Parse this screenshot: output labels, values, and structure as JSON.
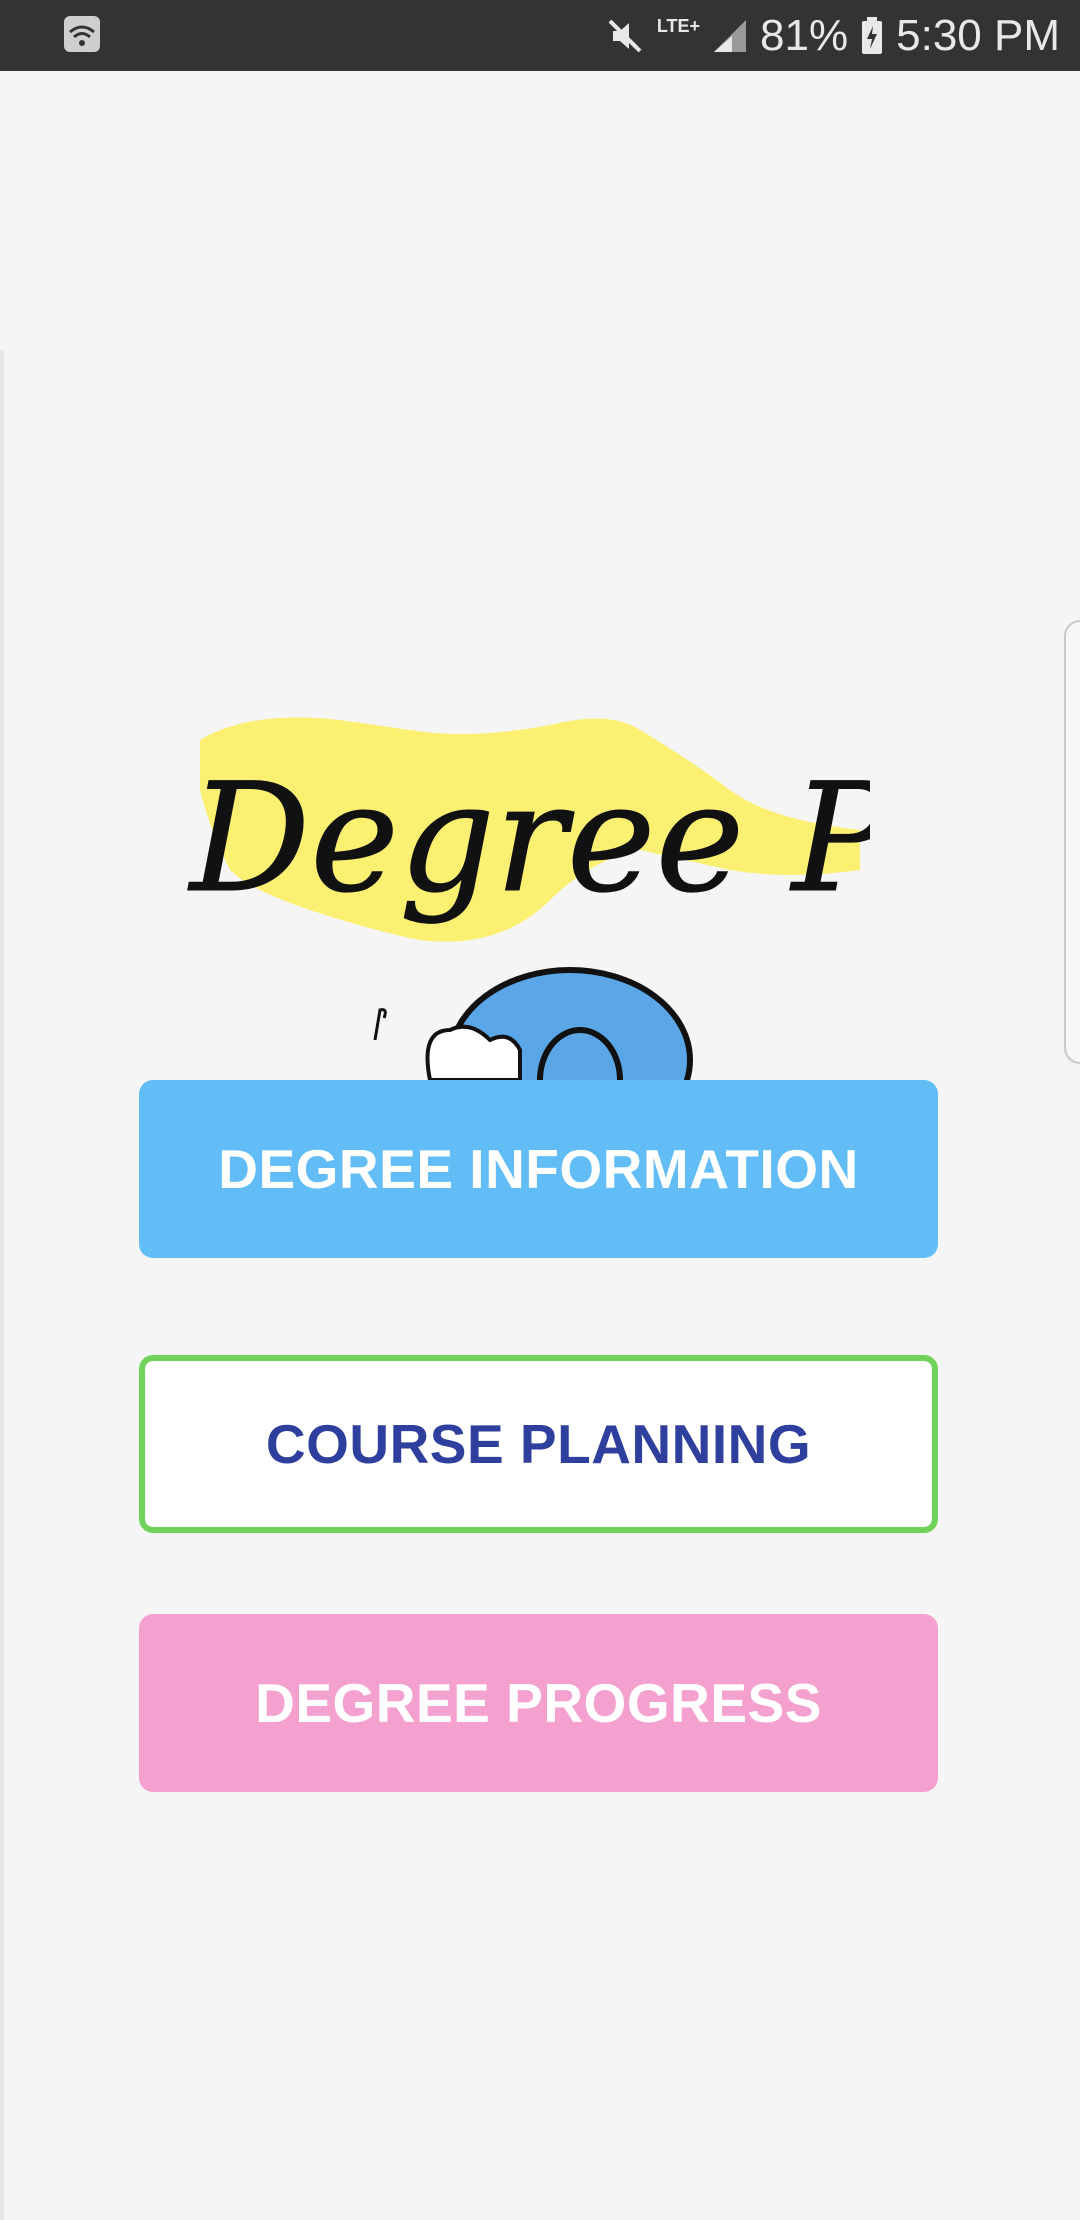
{
  "status_bar": {
    "network_label": "LTE+",
    "battery_percent": "81%",
    "time": "5:30 PM",
    "icons": [
      "wifi-icon",
      "mute-icon",
      "signal-icon",
      "battery-charging-icon"
    ]
  },
  "logo": {
    "text": "Degree Planner",
    "colors": {
      "highlight": "#fbef5a",
      "ink": "#111111",
      "mascot": "#5aa6e6"
    }
  },
  "buttons": {
    "degree_information": "DEGREE INFORMATION",
    "course_planning": "COURSE PLANNING",
    "degree_progress": "DEGREE PROGRESS"
  },
  "colors": {
    "status_bar": "#333333",
    "info_button": "#62bdf7",
    "course_border": "#6fd35b",
    "course_text": "#2f3f9e",
    "progress_button": "#f5a1cf"
  }
}
